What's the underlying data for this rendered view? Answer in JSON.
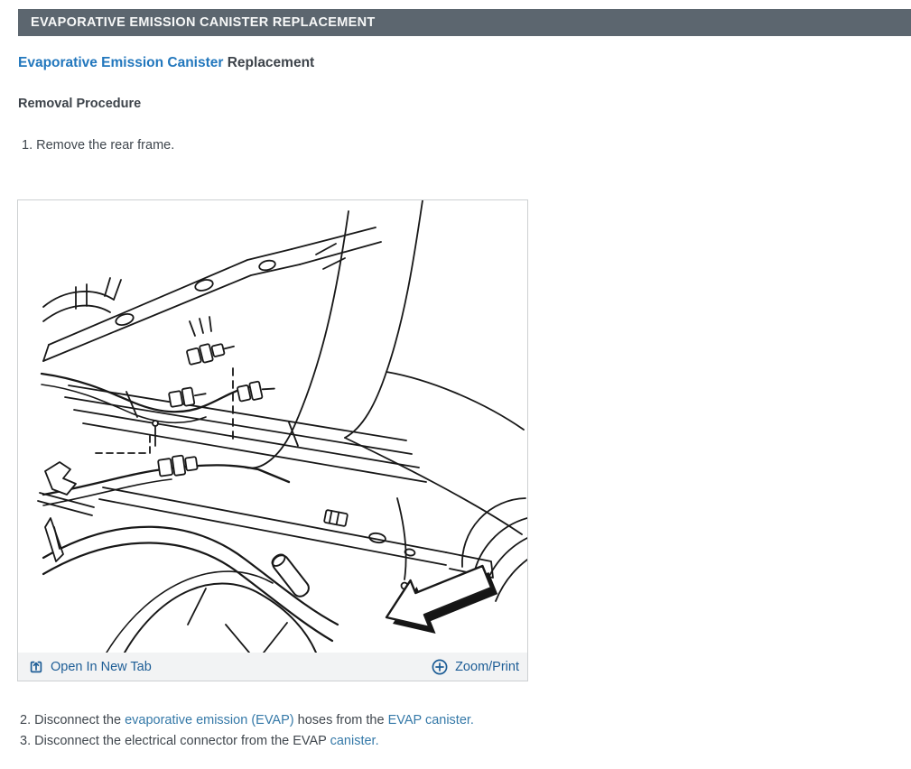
{
  "header": {
    "title": "EVAPORATIVE EMISSION CANISTER REPLACEMENT"
  },
  "article": {
    "title_link": "Evaporative Emission Canister",
    "title_rest": " Replacement",
    "subtitle": "Removal Procedure",
    "steps": {
      "step1": {
        "num": "1. ",
        "text": "Remove the rear frame."
      },
      "step2": {
        "num": "2. ",
        "t1": "Disconnect the ",
        "l1": "evaporative emission",
        "t2": " ",
        "l2": "(EVAP)",
        "t3": " hoses from the ",
        "l3": "EVAP canister."
      },
      "step3": {
        "num": "3. ",
        "t1": "Disconnect the electrical connector from the EVAP ",
        "l1": "canister."
      }
    }
  },
  "figure": {
    "open_label": "Open In New Tab",
    "zoom_label": "Zoom/Print",
    "icons": {
      "open": "open-in-new-tab-icon",
      "zoom": "circle-plus-icon"
    }
  },
  "colors": {
    "topbar_bg": "#5c666f",
    "heading_link": "#2277bd",
    "body_link": "#3579a8",
    "footer_link": "#1d5d96",
    "text_dark": "#3d434a",
    "figure_border": "#cdd0d2",
    "figure_bar_bg": "#f2f3f4"
  }
}
